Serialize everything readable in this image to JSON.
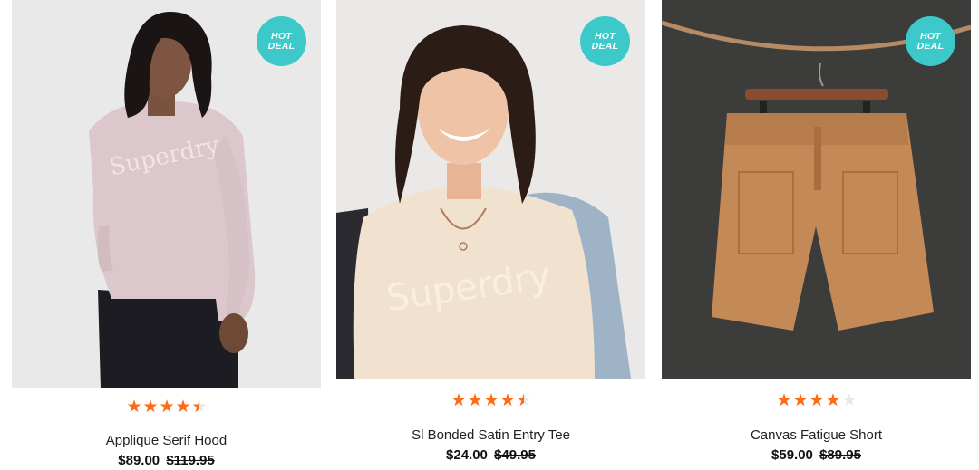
{
  "products": [
    {
      "name": "Applique Serif Hood",
      "price": "$89.00",
      "was_price": "$119.95",
      "badge_line1": "HOT",
      "badge_line2": "DEAL",
      "rating": 4.5,
      "image_icon": "model-wearing-pink-hoodie-image"
    },
    {
      "name": "Sl Bonded Satin Entry Tee",
      "price": "$24.00",
      "was_price": "$49.95",
      "badge_line1": "HOT",
      "badge_line2": "DEAL",
      "rating": 4.5,
      "image_icon": "model-wearing-cream-tee-image"
    },
    {
      "name": "Canvas Fatigue Short",
      "price": "$59.00",
      "was_price": "$89.95",
      "badge_line1": "HOT",
      "badge_line2": "DEAL",
      "rating": 4,
      "image_icon": "tan-shorts-on-hanger-image"
    }
  ],
  "colors": {
    "badge": "#3dc9c9",
    "star_filled": "#ff6a13",
    "star_empty": "#e8e8e8"
  }
}
